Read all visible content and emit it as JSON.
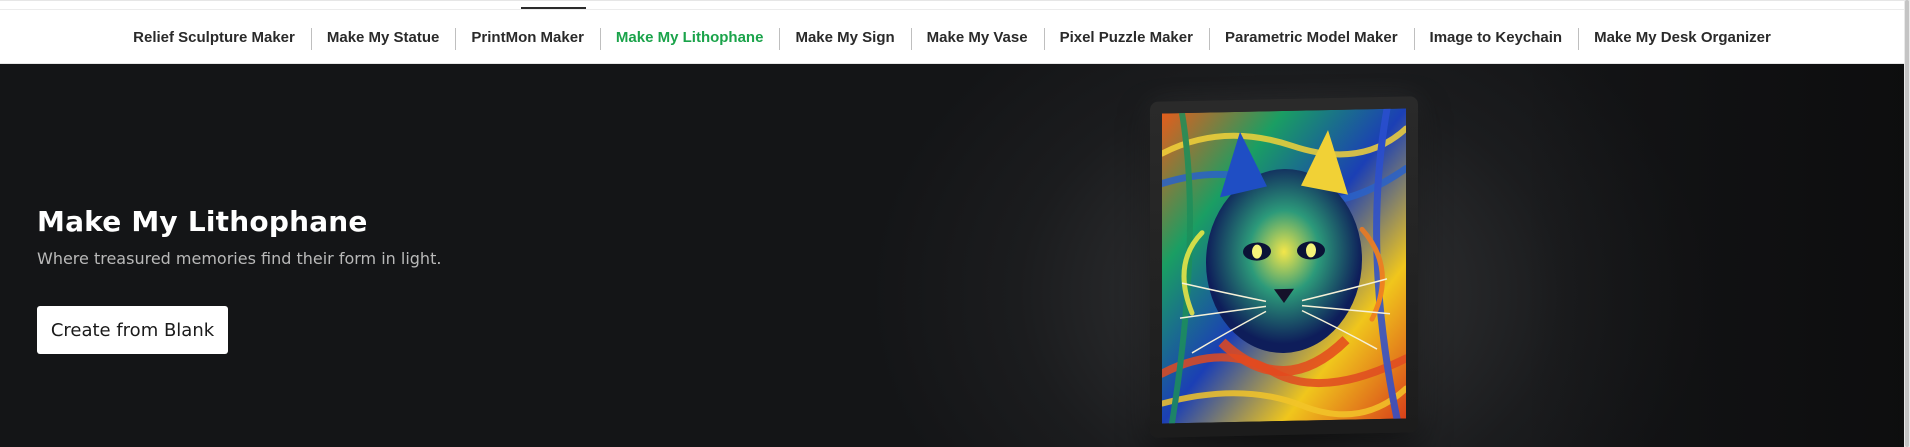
{
  "nav": {
    "items": [
      {
        "label": "Relief Sculpture Maker"
      },
      {
        "label": "Make My Statue"
      },
      {
        "label": "PrintMon Maker"
      },
      {
        "label": "Make My Lithophane",
        "active": true
      },
      {
        "label": "Make My Sign"
      },
      {
        "label": "Make My Vase"
      },
      {
        "label": "Pixel Puzzle Maker"
      },
      {
        "label": "Parametric Model Maker"
      },
      {
        "label": "Image to Keychain"
      },
      {
        "label": "Make My Desk Organizer"
      }
    ],
    "active_color": "#1aa34a"
  },
  "hero": {
    "title": "Make My Lithophane",
    "subtitle": "Where treasured memories find their form in light.",
    "button_label": "Create from Blank",
    "image_icon": "lithophane-cat-frame-image"
  },
  "colors": {
    "hero_bg": "#141517",
    "title": "#ffffff",
    "subtitle": "#b9b9b9",
    "button_bg": "#ffffff"
  }
}
